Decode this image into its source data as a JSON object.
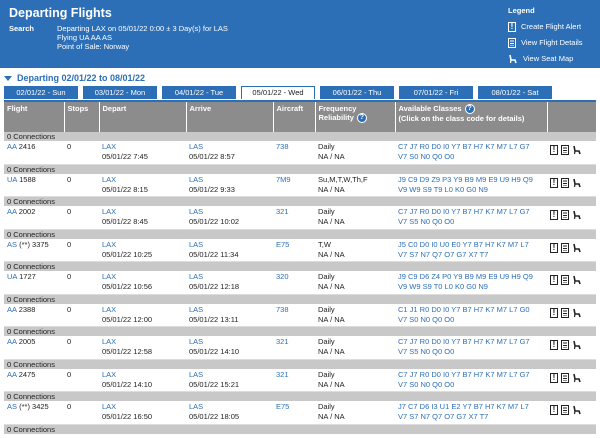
{
  "header": {
    "title": "Departing Flights",
    "search_label": "Search",
    "search_lines": [
      "Departing LAX on 05/01/22 0:00 ± 3 Day(s) for LAS",
      "Flying UA AA AS",
      "Point of Sale: Norway"
    ]
  },
  "legend": {
    "title": "Legend",
    "items": [
      {
        "label": "Create Flight Alert",
        "icon": "alert-icon"
      },
      {
        "label": "View Flight Details",
        "icon": "details-icon"
      },
      {
        "label": "View Seat Map",
        "icon": "seat-icon"
      }
    ]
  },
  "range_label": "Departing 02/01/22 to 08/01/22",
  "tabs": [
    "02/01/22 - Sun",
    "03/01/22 - Mon",
    "04/01/22 - Tue",
    "05/01/22 - Wed",
    "06/01/22 - Thu",
    "07/01/22 - Fri",
    "08/01/22 - Sat"
  ],
  "active_tab": 3,
  "columns": {
    "flight": "Flight",
    "stops": "Stops",
    "depart": "Depart",
    "arrive": "Arrive",
    "aircraft": "Aircraft",
    "frequency": "Frequency",
    "reliability": "Reliability",
    "classes": "Available Classes",
    "classes_hint": "(Click on the class code for details)"
  },
  "connection_label": "0 Connections",
  "flights": [
    {
      "airline": "AA",
      "num": "2416",
      "stops": "0",
      "dep_code": "LAX",
      "dep_time": "05/01/22 7:45",
      "arr_code": "LAS",
      "arr_time": "05/01/22 8:57",
      "aircraft": "738",
      "freq": "Daily",
      "rel": "NA / NA",
      "classes1": "C7 J7 R0 D0 I0 Y7 B7 H7 K7 M7 L7 G7",
      "classes2": "V7 S0 N0 Q0 O0"
    },
    {
      "airline": "UA",
      "num": "1588",
      "stops": "0",
      "dep_code": "LAX",
      "dep_time": "05/01/22 8:15",
      "arr_code": "LAS",
      "arr_time": "05/01/22 9:33",
      "aircraft": "7M9",
      "freq": "Su,M,T,W,Th,F",
      "rel": "NA / NA",
      "classes1": "J9 C9 D9 Z9 P3 Y9 B9 M9 E9 U9 H9 Q9",
      "classes2": "V9 W9 S9 T9 L0 K0 G0 N9"
    },
    {
      "airline": "AA",
      "num": "2002",
      "stops": "0",
      "dep_code": "LAX",
      "dep_time": "05/01/22 8:45",
      "arr_code": "LAS",
      "arr_time": "05/01/22 10:02",
      "aircraft": "321",
      "freq": "Daily",
      "rel": "NA / NA",
      "classes1": "C7 J7 R0 D0 I0 Y7 B7 H7 K7 M7 L7 G7",
      "classes2": "V7 S5 N0 Q0 O0"
    },
    {
      "airline": "AS",
      "num": "(**) 3375",
      "stops": "0",
      "dep_code": "LAX",
      "dep_time": "05/01/22 10:25",
      "arr_code": "LAS",
      "arr_time": "05/01/22 11:34",
      "aircraft": "E75",
      "freq": "T,W",
      "rel": "NA / NA",
      "classes1": "J5 C0 D0 I0 U0 E0 Y7 B7 H7 K7 M7 L7",
      "classes2": "V7 S7 N7 Q7 O7 G7 X7 T7"
    },
    {
      "airline": "UA",
      "num": "1727",
      "stops": "0",
      "dep_code": "LAX",
      "dep_time": "05/01/22 10:56",
      "arr_code": "LAS",
      "arr_time": "05/01/22 12:18",
      "aircraft": "320",
      "freq": "Daily",
      "rel": "NA / NA",
      "classes1": "J9 C9 D6 Z4 P0 Y9 B9 M9 E9 U9 H9 Q9",
      "classes2": "V9 W9 S9 T0 L0 K0 G0 N9"
    },
    {
      "airline": "AA",
      "num": "2388",
      "stops": "0",
      "dep_code": "LAX",
      "dep_time": "05/01/22 12:00",
      "arr_code": "LAS",
      "arr_time": "05/01/22 13:11",
      "aircraft": "738",
      "freq": "Daily",
      "rel": "NA / NA",
      "classes1": "C1 J1 R0 D0 I0 Y7 B7 H7 K7 M7 L7 G0",
      "classes2": "V7 S0 N0 Q0 O0"
    },
    {
      "airline": "AA",
      "num": "2005",
      "stops": "0",
      "dep_code": "LAX",
      "dep_time": "05/01/22 12:58",
      "arr_code": "LAS",
      "arr_time": "05/01/22 14:10",
      "aircraft": "321",
      "freq": "Daily",
      "rel": "NA / NA",
      "classes1": "C7 J7 R0 D0 I0 Y7 B7 H7 K7 M7 L7 G7",
      "classes2": "V7 S5 N0 Q0 O0"
    },
    {
      "airline": "AA",
      "num": "2475",
      "stops": "0",
      "dep_code": "LAX",
      "dep_time": "05/01/22 14:10",
      "arr_code": "LAS",
      "arr_time": "05/01/22 15:21",
      "aircraft": "321",
      "freq": "Daily",
      "rel": "NA / NA",
      "classes1": "C7 J7 R0 D0 I0 Y7 B7 H7 K7 M7 L7 G7",
      "classes2": "V7 S0 N0 Q0 O0"
    },
    {
      "airline": "AS",
      "num": "(**) 3425",
      "stops": "0",
      "dep_code": "LAX",
      "dep_time": "05/01/22 16:50",
      "arr_code": "LAS",
      "arr_time": "05/01/22 18:05",
      "aircraft": "E75",
      "freq": "Daily",
      "rel": "NA / NA",
      "classes1": "J7 C7 D6 I3 U1 E2 Y7 B7 H7 K7 M7 L7",
      "classes2": "V7 S7 N7 Q7 O7 G7 X7 T7"
    }
  ],
  "colors": {
    "header_bg": "#2c6fb7",
    "link": "#2c6fb7",
    "grid_header": "#8c8c8c",
    "connection_row": "#c8c8c8"
  }
}
